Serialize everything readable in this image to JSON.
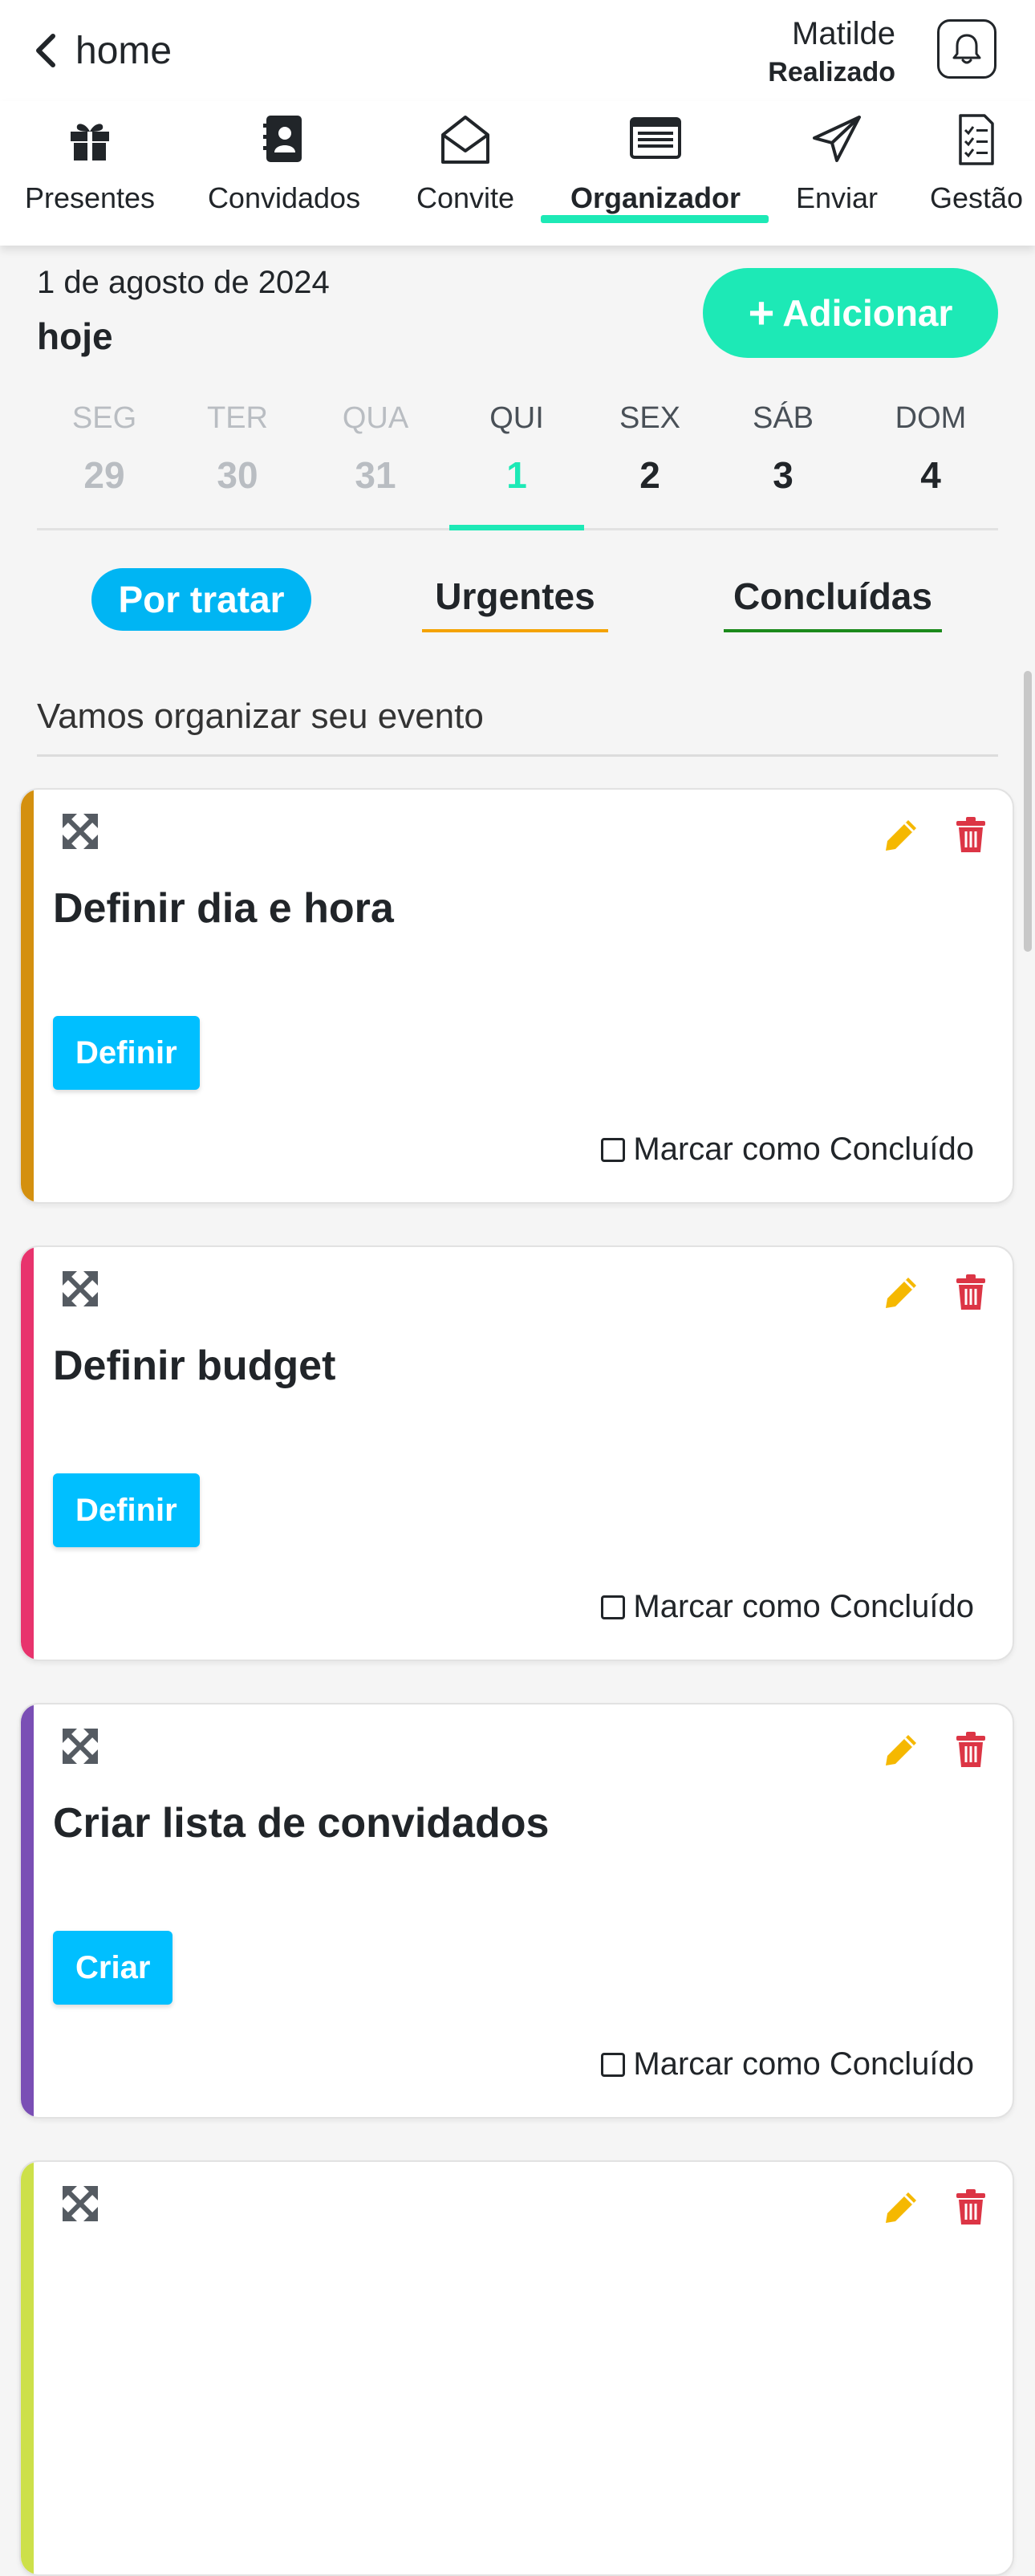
{
  "header": {
    "back_label": "home",
    "user_name": "Matilde",
    "user_status": "Realizado"
  },
  "tabs": [
    {
      "label": "Presentes",
      "icon": "gift-icon"
    },
    {
      "label": "Convidados",
      "icon": "address-book-icon"
    },
    {
      "label": "Convite",
      "icon": "envelope-open-icon"
    },
    {
      "label": "Organizador",
      "icon": "list-board-icon",
      "active": true
    },
    {
      "label": "Enviar",
      "icon": "paper-plane-icon"
    },
    {
      "label": "Gestão",
      "icon": "checklist-icon"
    }
  ],
  "date": {
    "full": "1 de agosto de 2024",
    "today": "hoje"
  },
  "add_button": "Adicionar",
  "week": [
    {
      "name": "SEG",
      "day": "29"
    },
    {
      "name": "TER",
      "day": "30"
    },
    {
      "name": "QUA",
      "day": "31"
    },
    {
      "name": "QUI",
      "day": "1"
    },
    {
      "name": "SEX",
      "day": "2"
    },
    {
      "name": "SÁB",
      "day": "3"
    },
    {
      "name": "DOM",
      "day": "4"
    }
  ],
  "filters": {
    "active": "Por tratar",
    "urgent": "Urgentes",
    "done": "Concluídas"
  },
  "section_title": "Vamos organizar seu evento",
  "tasks": [
    {
      "title": "Definir dia e hora",
      "button": "Definir",
      "checkbox": "Marcar como Concluído",
      "accent": "#d4900f"
    },
    {
      "title": "Definir budget",
      "button": "Definir",
      "checkbox": "Marcar como Concluído",
      "accent": "#e8336d"
    },
    {
      "title": "Criar lista de convidados",
      "button": "Criar",
      "checkbox": "Marcar como Concluído",
      "accent": "#7a4fb5"
    },
    {
      "title": "",
      "button": "",
      "checkbox": "",
      "accent": "#cde04a"
    }
  ],
  "colors": {
    "brand": "#1de9b6",
    "primary_button": "#00bfff",
    "edit": "#f5b800",
    "delete": "#dc3545"
  }
}
